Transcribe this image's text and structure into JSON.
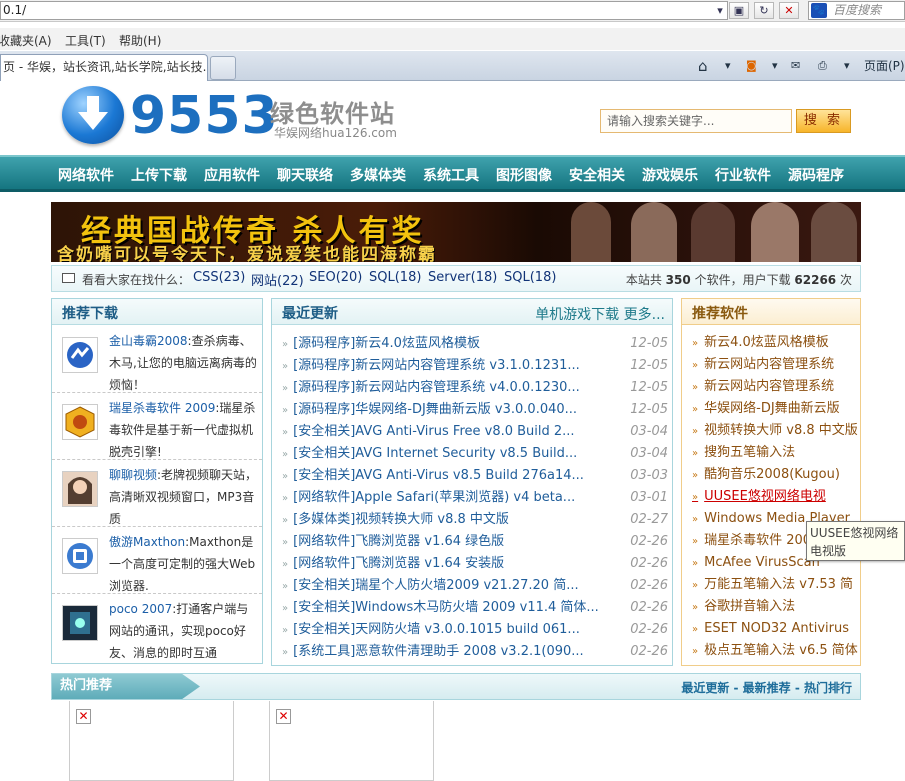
{
  "browser": {
    "address": "0.1/",
    "search_placeholder": "百度搜索",
    "menu": [
      "收藏夹(A)",
      "工具(T)",
      "帮助(H)"
    ],
    "tab_title": "页 - 华娱，站长资讯,站长学院,站长技...",
    "page_menu": "页面(P)"
  },
  "header": {
    "logo_number": "9553",
    "logo_title": "绿色软件站",
    "logo_sub": "华娱网络hua126.com",
    "search_placeholder": "请输入搜索关键字...",
    "search_button": "搜 索"
  },
  "nav": [
    "网络软件",
    "上传下载",
    "应用软件",
    "聊天联络",
    "多媒体类",
    "系统工具",
    "图形图像",
    "安全相关",
    "游戏娱乐",
    "行业软件",
    "源码程序"
  ],
  "banner": {
    "line1": "经典国战传奇 杀人有奖",
    "line2": "含奶嘴可以号令天下，爱说爱笑也能四海称霸"
  },
  "keywords": {
    "label": "看看大家在找什么：",
    "items": [
      "CSS(23)",
      "网站(22)",
      "SEO(20)",
      "SQL(18)",
      "Server(18)",
      "SQL(18)"
    ],
    "stats_prefix": "本站共",
    "software_count": "350",
    "stats_mid": "个软件，用户下载",
    "download_count": "62266",
    "stats_suffix": "次"
  },
  "recommend_downloads": {
    "title": "推荐下载",
    "items": [
      {
        "name": "金山毒霸2008",
        "desc": ":查杀病毒、木马,让您的电脑远离病毒的烦恼！",
        "icon": "kingsoft-icon"
      },
      {
        "name": "瑞星杀毒软件 2009",
        "desc": ":瑞星杀毒软件是基于新一代虚拟机脱壳引擎!",
        "icon": "rising-lion-icon"
      },
      {
        "name": "聊聊视频",
        "desc": ":老牌视频聊天站，高清晰双视频窗口，MP3音质",
        "icon": "avatar-icon"
      },
      {
        "name": "傲游Maxthon",
        "desc": ":Maxthon是一个高度可定制的强大Web浏览器.",
        "icon": "maxthon-icon"
      },
      {
        "name": "poco 2007",
        "desc": ":打通客户端与网站的通讯，实现poco好友、消息的即时互通",
        "icon": "poco-icon"
      }
    ]
  },
  "latest": {
    "title": "最近更新",
    "more": "单机游戏下载 更多...",
    "items": [
      {
        "text": "[源码程序]新云4.0炫蓝风格模板",
        "date": "12-05"
      },
      {
        "text": "[源码程序]新云网站内容管理系统 v3.1.0.1231...",
        "date": "12-05"
      },
      {
        "text": "[源码程序]新云网站内容管理系统 v4.0.0.1230...",
        "date": "12-05"
      },
      {
        "text": "[源码程序]华娱网络-DJ舞曲新云版 v3.0.0.040...",
        "date": "12-05"
      },
      {
        "text": "[安全相关]AVG Anti-Virus Free v8.0 Build 2...",
        "date": "03-04"
      },
      {
        "text": "[安全相关]AVG Internet Security v8.5 Build...",
        "date": "03-04"
      },
      {
        "text": "[安全相关]AVG Anti-Virus v8.5 Build 276a14...",
        "date": "03-03"
      },
      {
        "text": "[网络软件]Apple Safari(苹果浏览器) v4 beta...",
        "date": "03-01"
      },
      {
        "text": "[多媒体类]视频转换大师 v8.8 中文版",
        "date": "02-27"
      },
      {
        "text": "[网络软件]飞腾浏览器 v1.64 绿色版",
        "date": "02-26"
      },
      {
        "text": "[网络软件]飞腾浏览器 v1.64 安装版",
        "date": "02-26"
      },
      {
        "text": "[安全相关]瑞星个人防火墙2009 v21.27.20 简...",
        "date": "02-26"
      },
      {
        "text": "[安全相关]Windows木马防火墙 2009 v11.4 简体...",
        "date": "02-26"
      },
      {
        "text": "[安全相关]天网防火墙 v3.0.0.1015 build 061...",
        "date": "02-26"
      },
      {
        "text": "[系统工具]恶意软件清理助手 2008 v3.2.1(090...",
        "date": "02-26"
      }
    ]
  },
  "recommend_software": {
    "title": "推荐软件",
    "items": [
      "新云4.0炫蓝风格模板",
      "新云网站内容管理系统",
      "新云网站内容管理系统",
      "华娱网络-DJ舞曲新云版",
      "视频转换大师 v8.8 中文版",
      "搜狗五笔输入法",
      "酷狗音乐2008(Kugou)",
      "UUSEE悠视网络电视",
      "Windows Media Player",
      "瑞星杀毒软件 200",
      "McAfee VirusScan",
      "万能五笔输入法 v7.53 简",
      "谷歌拼音输入法",
      "ESET NOD32 Antivirus",
      "极点五笔输入法 v6.5 简体"
    ],
    "hover_index": 7
  },
  "tooltip": "UUSEE悠视网络电视版",
  "hot": {
    "title": "热门推荐",
    "tabs": "最近更新 - 最新推荐 - 热门排行"
  }
}
